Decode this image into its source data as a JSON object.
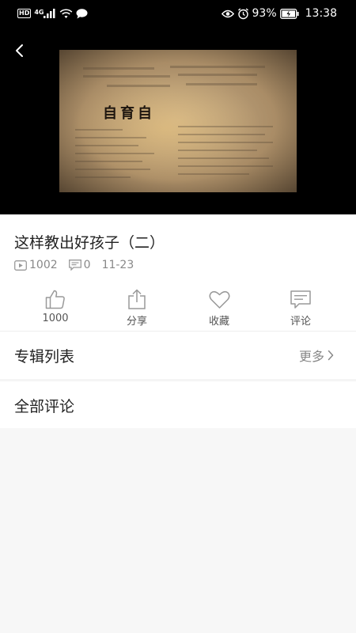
{
  "status_bar": {
    "network_badge": "HD",
    "network_type": "4G",
    "battery": "93%",
    "time": "13:38",
    "icons": [
      "hd-icon",
      "signal-icon",
      "wifi-icon",
      "message-icon",
      "eye-icon",
      "alarm-icon",
      "battery-icon"
    ]
  },
  "player": {
    "back_icon": "back-arrow-icon",
    "video_caption": "自育自"
  },
  "video": {
    "title": "这样教出好孩子（二）",
    "plays": "1002",
    "comments_count": "0",
    "date": "11-23"
  },
  "actions": [
    {
      "icon": "thumbs-up-icon",
      "label": "1000"
    },
    {
      "icon": "share-icon",
      "label": "分享"
    },
    {
      "icon": "heart-icon",
      "label": "收藏"
    },
    {
      "icon": "comment-icon",
      "label": "评论"
    }
  ],
  "album_section": {
    "title": "专辑列表",
    "more_label": "更多"
  },
  "comments_section": {
    "title": "全部评论"
  },
  "colors": {
    "background": "#f7f7f7",
    "surface": "#ffffff",
    "text_primary": "#222222",
    "text_secondary": "#888888",
    "icon_gray": "#9a9a9a"
  }
}
